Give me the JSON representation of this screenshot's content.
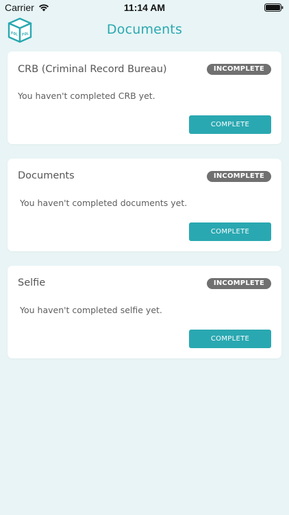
{
  "status_bar": {
    "carrier": "Carrier",
    "time": "11:14 AM",
    "wifi_icon": "wifi-icon",
    "battery_icon": "battery-icon"
  },
  "header": {
    "title": "Documents",
    "logo_icon": "app-logo-box-icon",
    "logo_text_left": "FOL",
    "logo_text_right": "FOL"
  },
  "colors": {
    "accent": "#2aa8b1",
    "background": "#e8f4f5",
    "badge": "#707070",
    "card": "#ffffff"
  },
  "cards": [
    {
      "title": "CRB (Criminal Record Bureau)",
      "status": "INCOMPLETE",
      "message": "You haven't completed CRB yet.",
      "action_label": "COMPLETE"
    },
    {
      "title": "Documents",
      "status": "INCOMPLETE",
      "message": "You haven't completed documents yet.",
      "action_label": "COMPLETE"
    },
    {
      "title": "Selfie",
      "status": "INCOMPLETE",
      "message": "You haven't completed selfie yet.",
      "action_label": "COMPLETE"
    }
  ]
}
